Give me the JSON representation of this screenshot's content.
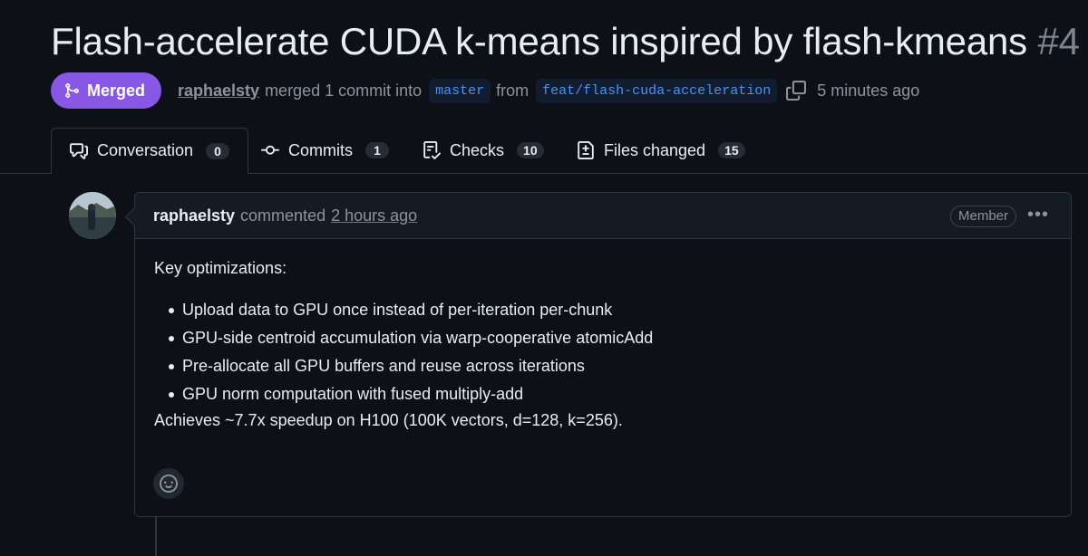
{
  "pr": {
    "title": "Flash-accelerate CUDA k-means inspired by flash-kmeans",
    "number": "#4",
    "status": "Merged",
    "author": "raphaelsty",
    "merge_text": "merged 1 commit into",
    "base_branch": "master",
    "from_text": "from",
    "head_branch": "feat/flash-cuda-acceleration",
    "time": "5 minutes ago"
  },
  "tabs": [
    {
      "label": "Conversation",
      "count": "0",
      "icon": "comment-discussion-icon"
    },
    {
      "label": "Commits",
      "count": "1",
      "icon": "git-commit-icon"
    },
    {
      "label": "Checks",
      "count": "10",
      "icon": "checklist-icon"
    },
    {
      "label": "Files changed",
      "count": "15",
      "icon": "file-diff-icon"
    }
  ],
  "comment": {
    "author": "raphaelsty",
    "verb": "commented",
    "time": "2 hours ago",
    "role": "Member",
    "intro": "Key optimizations:",
    "bullets": [
      "Upload data to GPU once instead of per-iteration per-chunk",
      "GPU-side centroid accumulation via warp-cooperative atomicAdd",
      "Pre-allocate all GPU buffers and reuse across iterations",
      "GPU norm computation with fused multiply-add"
    ],
    "result": "Achieves ~7.7x speedup on H100 (100K vectors, d=128, k=256)."
  },
  "colors": {
    "merged": "#8957e5",
    "background": "#0d1117",
    "link_blue": "#4493f8"
  }
}
